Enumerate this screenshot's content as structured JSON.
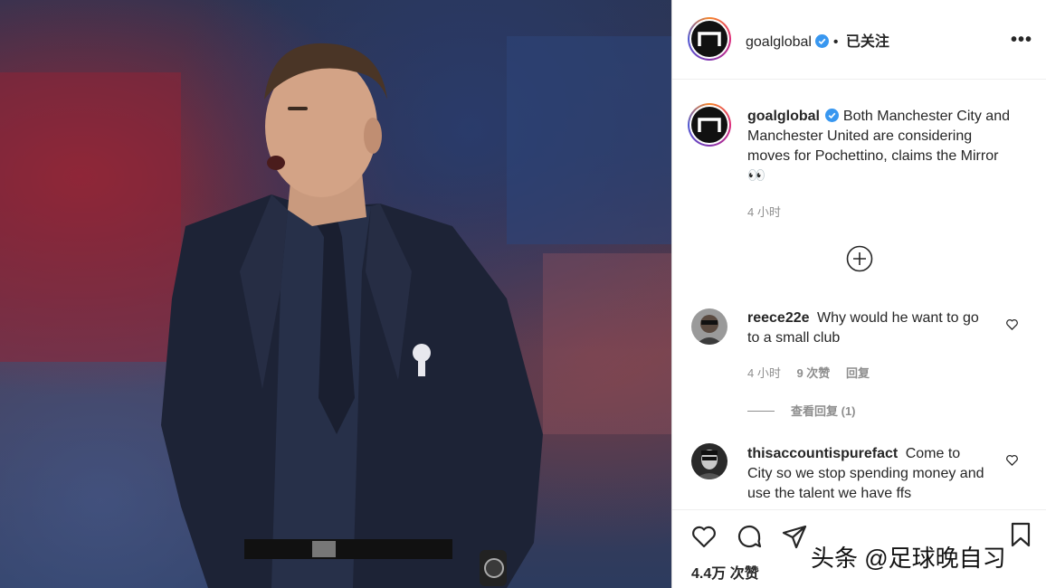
{
  "post": {
    "username": "goalglobal",
    "follow_status": "已关注",
    "more_icon": "more-horizontal-icon",
    "caption": "Both Manchester City and Manchester United are considering moves for Pochettino, claims the Mirror 👀",
    "time": "4 小时",
    "load_more_icon": "plus-circle-icon"
  },
  "comments": [
    {
      "username": "reece22e",
      "text": "Why would he want to go to a small club",
      "time": "4 小时",
      "likes": "9 次赞",
      "reply": "回复",
      "view_replies": "查看回复 (1)"
    },
    {
      "username": "thisaccountispurefact",
      "text": "Come to City so we stop spending money and use the talent we have ffs"
    }
  ],
  "actions": {
    "like_icon": "heart-icon",
    "comment_icon": "comment-icon",
    "share_icon": "send-icon",
    "save_icon": "bookmark-icon",
    "likes_count": "4.4万 次赞"
  },
  "watermark": "头条 @足球晚自习",
  "colors": {
    "verified": "#3897f0",
    "secondary_text": "#8e8e8e",
    "border": "#dbdbdb"
  }
}
